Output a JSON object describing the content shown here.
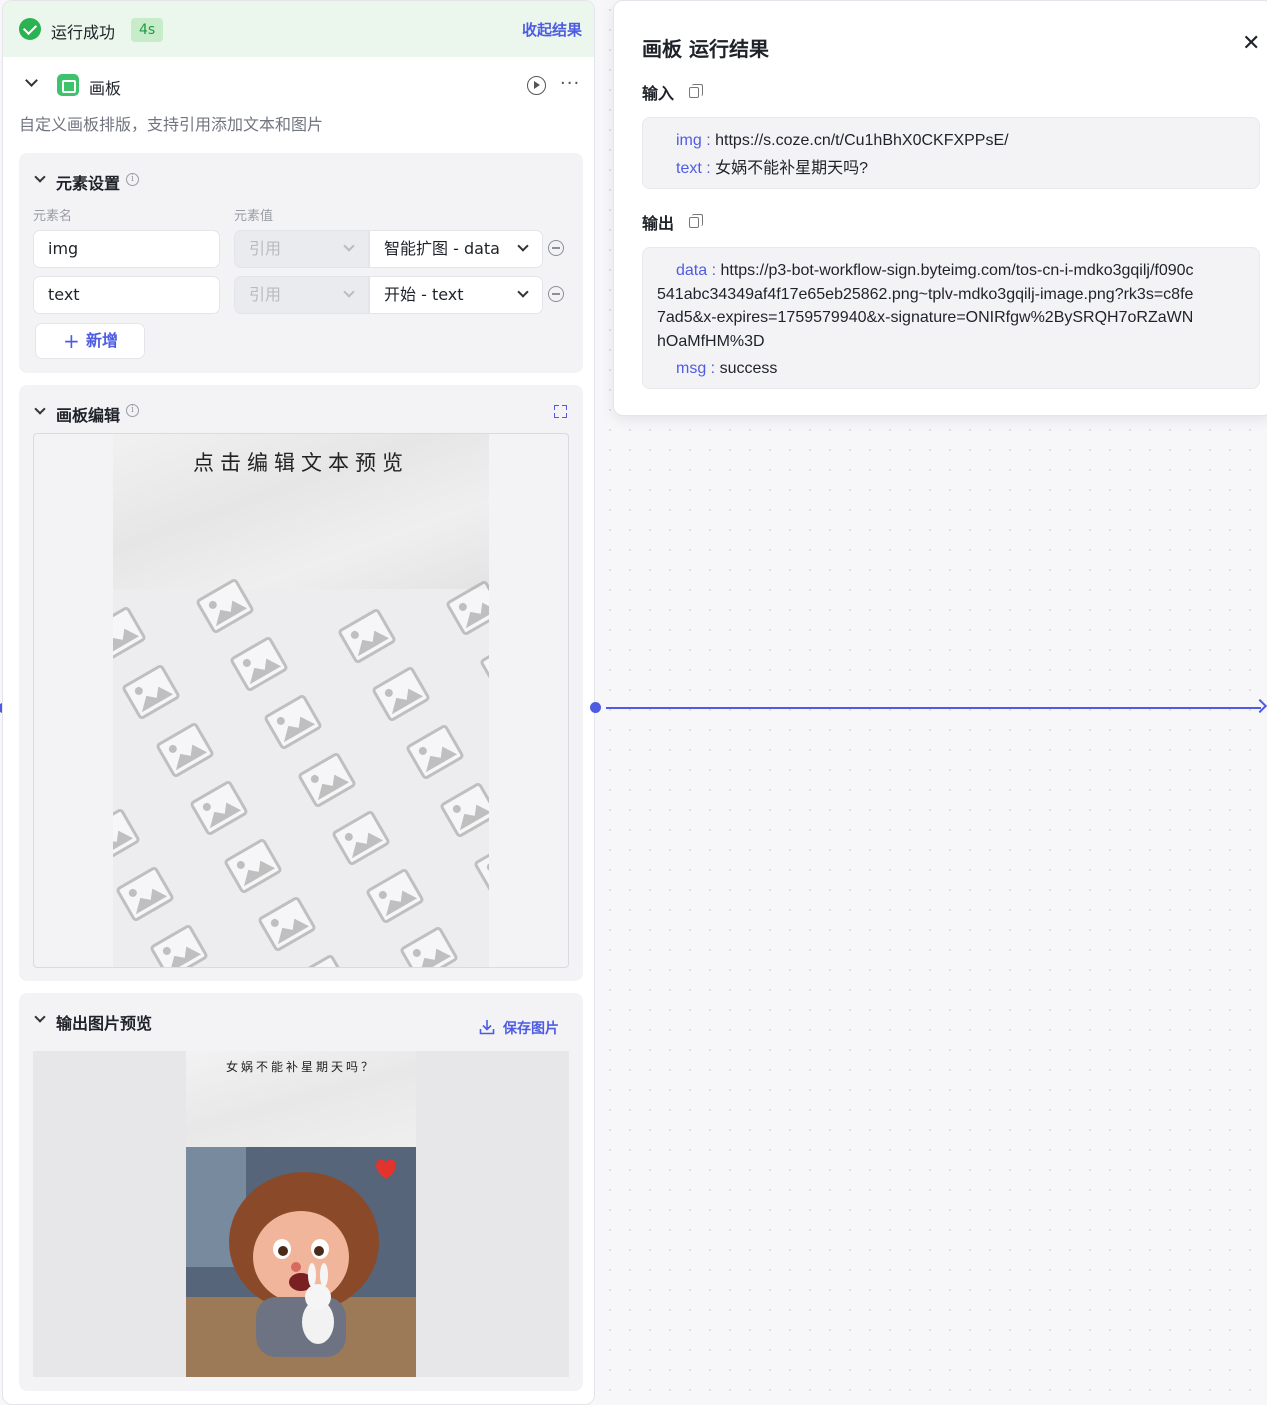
{
  "status": {
    "text": "运行成功",
    "duration": "4s",
    "collapse_label": "收起结果"
  },
  "node": {
    "title": "画板",
    "description": "自定义画板排版，支持引用添加文本和图片"
  },
  "element_settings": {
    "title": "元素设置",
    "col_name_label": "元素名",
    "col_value_label": "元素值",
    "rows": [
      {
        "name": "img",
        "ref_mode": "引用",
        "value": "智能扩图 - data"
      },
      {
        "name": "text",
        "ref_mode": "引用",
        "value": "开始 - text"
      }
    ],
    "add_label": "新增"
  },
  "canvas_editor": {
    "title": "画板编辑",
    "placeholder_text": "点击编辑文本预览"
  },
  "output_preview": {
    "title": "输出图片预览",
    "save_label": "保存图片",
    "image_text": "女娲不能补星期天吗？"
  },
  "result_panel": {
    "title": "画板 运行结果",
    "input_label": "输入",
    "input": [
      {
        "key": "img",
        "value": "https://s.coze.cn/t/Cu1hBhX0CKFXPPsE/"
      },
      {
        "key": "text",
        "value": "女娲不能补星期天吗?"
      }
    ],
    "output_label": "输出",
    "output": [
      {
        "key": "data",
        "value": "https://p3-bot-workflow-sign.byteimg.com/tos-cn-i-mdko3gqilj/f090c541abc34349af4f17e65eb25862.png~tplv-mdko3gqilj-image.png?rk3s=c8fe7ad5&x-expires=1759579940&x-signature=ONIRfgw%2BySRQH7oRZaWNhOaMfHM%3D"
      },
      {
        "key": "msg",
        "value": "success"
      }
    ]
  },
  "colors": {
    "accent": "#4e5ce3",
    "success": "#2bb352",
    "node_icon": "#3ec26c"
  },
  "icons": [
    "check-circle-icon",
    "chevron-down-icon",
    "canvas-node-icon",
    "play-circle-icon",
    "more-icon",
    "info-icon",
    "minus-circle-icon",
    "plus-icon",
    "expand-icon",
    "download-icon",
    "close-icon",
    "copy-icon",
    "image-placeholder-icon"
  ]
}
